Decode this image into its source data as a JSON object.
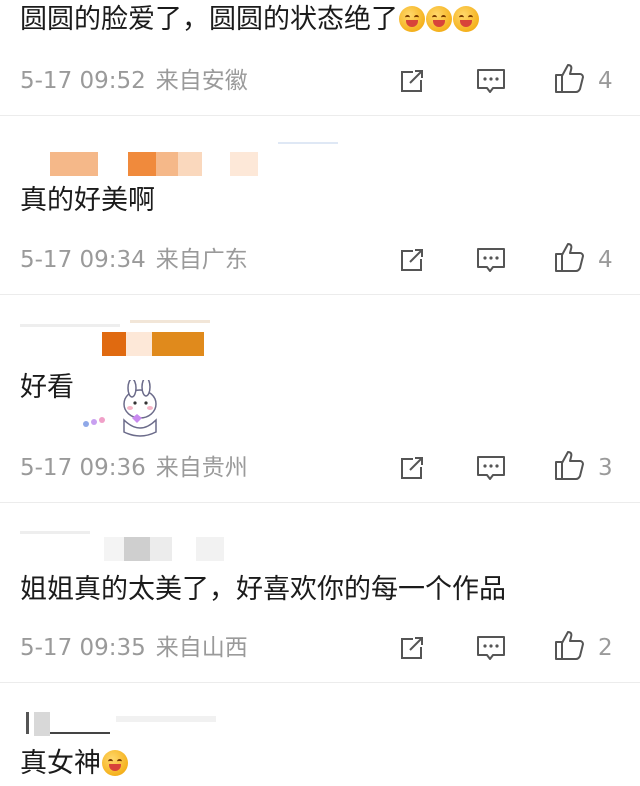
{
  "comments": [
    {
      "text": "圆圆的脸爱了，圆圆的状态绝了",
      "emoji": [
        "hug-face",
        "hug-face",
        "hug-face"
      ],
      "time": "5-17 09:52",
      "location": "来自安徽",
      "likes": "4"
    },
    {
      "text": "真的好美啊",
      "time": "5-17 09:34",
      "location": "来自广东",
      "likes": "4"
    },
    {
      "text": "好看",
      "time": "5-17 09:36",
      "location": "来自贵州",
      "likes": "3"
    },
    {
      "text": "姐姐真的太美了，好喜欢你的每一个作品",
      "time": "5-17 09:35",
      "location": "来自山西",
      "likes": "2"
    },
    {
      "text": "真女神",
      "emoji": [
        "scream-face"
      ]
    }
  ],
  "icons": {
    "share": "share-icon",
    "reply": "comment-icon",
    "like": "thumbs-up-icon"
  },
  "colors": {
    "meta_text": "#9a9a9a",
    "redact_orange": "#f08a3c",
    "redact_orange_dark": "#e06a10"
  }
}
